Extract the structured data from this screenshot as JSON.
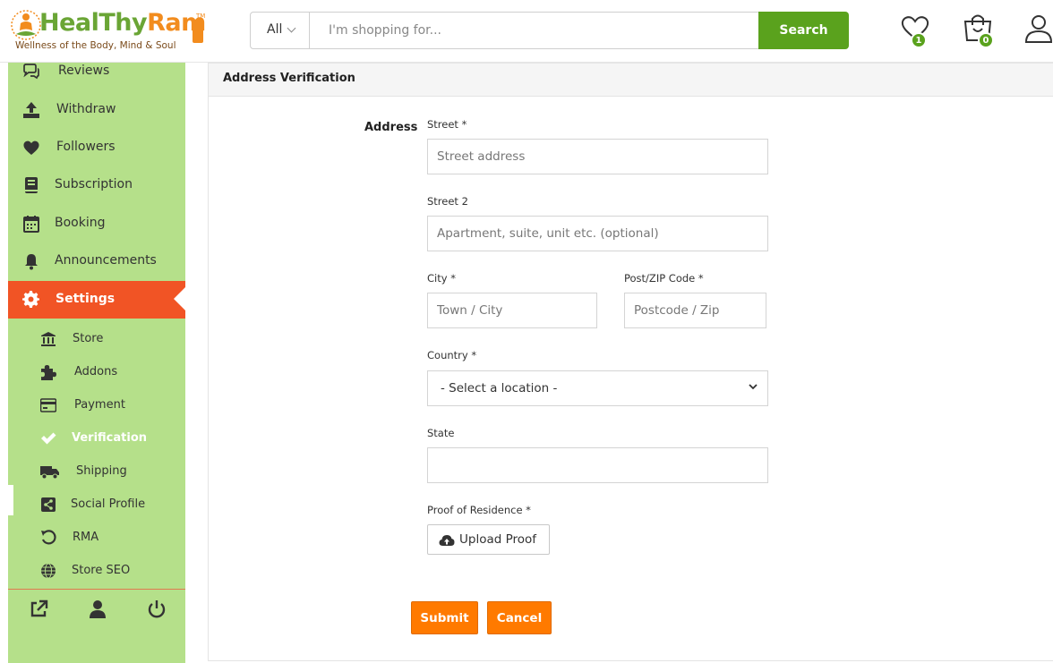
{
  "brand": {
    "name_part1": "HealThy",
    "name_part2": "Ram",
    "tagline": "Wellness of the Body, Mind & Soul",
    "tm": "TM",
    "colors": {
      "green": "#6aa535",
      "orange": "#f28c1e"
    }
  },
  "search": {
    "category": "All",
    "placeholder": "I'm shopping for...",
    "button_label": "Search"
  },
  "header_icons": {
    "wishlist": {
      "icon": "heart-icon",
      "count": "1"
    },
    "cart": {
      "icon": "shopping-bag-icon",
      "count": "0"
    },
    "account": {
      "icon": "user-icon"
    }
  },
  "sidebar": {
    "items": [
      {
        "label": "Reviews",
        "icon": "reviews-icon"
      },
      {
        "label": "Withdraw",
        "icon": "upload-icon"
      },
      {
        "label": "Followers",
        "icon": "heart-icon"
      },
      {
        "label": "Subscription",
        "icon": "book-icon"
      },
      {
        "label": "Booking",
        "icon": "calendar-icon"
      },
      {
        "label": "Announcements",
        "icon": "bell-icon"
      },
      {
        "label": "Settings",
        "icon": "gear-icon"
      }
    ],
    "sub_items": [
      {
        "label": "Store",
        "icon": "bank-icon"
      },
      {
        "label": "Addons",
        "icon": "puzzle-icon"
      },
      {
        "label": "Payment",
        "icon": "credit-card-icon"
      },
      {
        "label": "Verification",
        "icon": "check-icon"
      },
      {
        "label": "Shipping",
        "icon": "truck-icon"
      },
      {
        "label": "Social Profile",
        "icon": "share-icon"
      },
      {
        "label": "RMA",
        "icon": "undo-icon"
      },
      {
        "label": "Store SEO",
        "icon": "globe-icon"
      }
    ],
    "footer_icons": [
      "external-link-icon",
      "user-icon",
      "power-icon"
    ],
    "colors": {
      "background": "#b5e08a",
      "active": "#f15425"
    }
  },
  "panel": {
    "title": "Address Verification",
    "address_label": "Address",
    "street": {
      "label": "Street *",
      "placeholder": "Street address",
      "value": ""
    },
    "street2": {
      "label": "Street 2",
      "placeholder": "Apartment, suite, unit etc. (optional)",
      "value": ""
    },
    "city": {
      "label": "City *",
      "placeholder": "Town / City",
      "value": ""
    },
    "zip": {
      "label": "Post/ZIP Code *",
      "placeholder": "Postcode / Zip",
      "value": ""
    },
    "country": {
      "label": "Country *",
      "selected": "- Select a location -"
    },
    "state": {
      "label": "State",
      "value": ""
    },
    "proof": {
      "label": "Proof of Residence *",
      "button_label": "Upload Proof"
    },
    "submit_label": "Submit",
    "cancel_label": "Cancel",
    "colors": {
      "button": "#ff7a00",
      "search_button": "#5aa21d"
    }
  }
}
